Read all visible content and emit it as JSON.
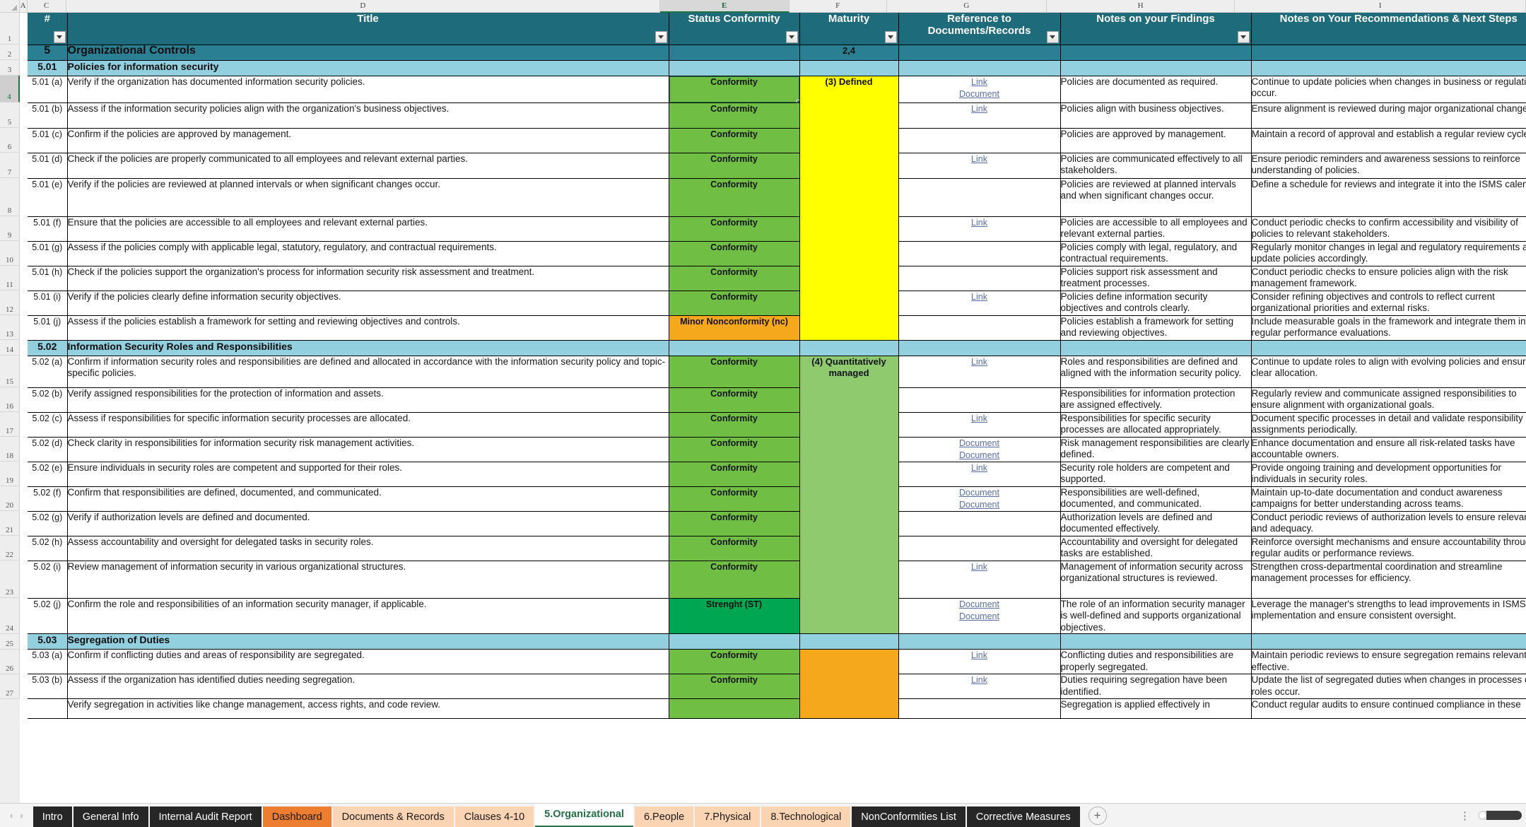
{
  "spreadsheet": {
    "column_letters": [
      "A",
      "C",
      "D",
      "E",
      "F",
      "G",
      "H",
      "I"
    ],
    "selected_column": "E",
    "selected_row": "4",
    "selected_cell_value": "Conformity",
    "row_numbers": [
      "1",
      "2",
      "3",
      "4",
      "5",
      "6",
      "7",
      "8",
      "9",
      "10",
      "11",
      "12",
      "13",
      "14",
      "15",
      "16",
      "17",
      "18",
      "19",
      "20",
      "21",
      "22",
      "23",
      "24",
      "25",
      "26",
      "27"
    ]
  },
  "headers": {
    "num": "#",
    "title": "Title",
    "status": "Status Conformity",
    "maturity": "Maturity",
    "reference": "Reference to\nDocuments/Records",
    "reference_line1": "Reference to",
    "reference_line2": "Documents/Records",
    "findings": "Notes on your Findings",
    "recommendations": "Notes on Your Recommendations & Next Steps"
  },
  "colors": {
    "header_teal": "#1e6b7b",
    "section_main": "#2b7f92",
    "section_sub": "#92cfdf",
    "conformity_green": "#70bf44",
    "minor_orange": "#f5a81c",
    "strength_green": "#00a651",
    "maturity_yellow": "#ffff00",
    "maturity_green": "#8fcb6e",
    "maturity_orange": "#f5a81c",
    "link_blue": "#5b6fa8",
    "excel_accent": "#217346"
  },
  "sections": [
    {
      "type": "section_main",
      "num": "5",
      "title": "Organizational Controls",
      "maturity": "2,4"
    },
    {
      "type": "section_sub",
      "num": "5.01",
      "title": "Policies for information security"
    }
  ],
  "maturity_groups": [
    {
      "label": "(3) Defined",
      "color": "mat-yellow",
      "rows": 10
    },
    {
      "label": "(4) Quantitatively managed",
      "color": "mat-green",
      "rows": 10
    },
    {
      "label": "",
      "color": "mat-orange",
      "rows": 3
    }
  ],
  "rows": [
    {
      "kind": "section_main",
      "num": "5",
      "title": "Organizational Controls",
      "status": "",
      "maturity": "2,4",
      "refs": [],
      "findings": "",
      "recommendations": ""
    },
    {
      "kind": "section_sub",
      "num": "5.01",
      "title": "Policies for information security",
      "status": "",
      "maturity": "",
      "refs": [],
      "findings": "",
      "recommendations": ""
    },
    {
      "kind": "item",
      "num": "5.01 (a)",
      "title": "Verify if the organization has documented information security policies.",
      "status": "Conformity",
      "status_class": "st-conf",
      "refs": [
        "Link",
        "Document"
      ],
      "findings": "Policies are documented as required.",
      "recommendations": "Continue to update policies when changes in business or regulations occur."
    },
    {
      "kind": "item",
      "num": "5.01 (b)",
      "title": "Assess if the information security policies align with the organization's business objectives.",
      "status": "Conformity",
      "status_class": "st-conf",
      "refs": [
        "Link"
      ],
      "findings": "Policies align with business objectives.",
      "recommendations": "Ensure alignment is reviewed during major organizational changes."
    },
    {
      "kind": "item",
      "num": "5.01 (c)",
      "title": "Confirm if the policies are approved by management.",
      "status": "Conformity",
      "status_class": "st-conf",
      "refs": [],
      "findings": "Policies are approved by management.",
      "recommendations": "Maintain a record of approval and establish a regular review cycle."
    },
    {
      "kind": "item",
      "num": "5.01 (d)",
      "title": "Check if the policies are properly communicated to all employees and relevant external parties.",
      "status": "Conformity",
      "status_class": "st-conf",
      "refs": [
        "Link"
      ],
      "findings": "Policies are communicated effectively to all stakeholders.",
      "recommendations": "Ensure periodic reminders and awareness sessions to reinforce understanding of policies."
    },
    {
      "kind": "item",
      "num": "5.01 (e)",
      "title": "Verify if the policies are reviewed at planned intervals or when significant changes occur.",
      "status": "Conformity",
      "status_class": "st-conf",
      "refs": [],
      "findings": "Policies are reviewed at planned intervals and when significant changes occur.",
      "recommendations": "Define a schedule for reviews and integrate it into the ISMS calendar."
    },
    {
      "kind": "item",
      "num": "5.01 (f)",
      "title": "Ensure that the policies are accessible to all employees and relevant external parties.",
      "status": "Conformity",
      "status_class": "st-conf",
      "refs": [
        "Link"
      ],
      "findings": "Policies are accessible to all employees and relevant external parties.",
      "recommendations": "Conduct periodic checks to confirm accessibility and visibility of policies to relevant stakeholders."
    },
    {
      "kind": "item",
      "num": "5.01 (g)",
      "title": "Assess if the policies comply with applicable legal, statutory, regulatory, and contractual requirements.",
      "status": "Conformity",
      "status_class": "st-conf",
      "refs": [],
      "findings": "Policies comply with legal, regulatory, and contractual requirements.",
      "recommendations": "Regularly monitor changes in legal and regulatory requirements and update policies accordingly."
    },
    {
      "kind": "item",
      "num": "5.01 (h)",
      "title": "Check if the policies support the organization's process for information security risk assessment and treatment.",
      "status": "Conformity",
      "status_class": "st-conf",
      "refs": [],
      "findings": "Policies support risk assessment and treatment processes.",
      "recommendations": "Conduct periodic checks to ensure policies align with the risk management framework."
    },
    {
      "kind": "item",
      "num": "5.01 (i)",
      "title": "Verify if the policies clearly define information security objectives.",
      "status": "Conformity",
      "status_class": "st-conf",
      "refs": [
        "Link"
      ],
      "findings": "Policies define information security objectives and controls clearly.",
      "recommendations": "Consider refining objectives and controls to reflect current organizational priorities and external risks."
    },
    {
      "kind": "item",
      "num": "5.01 (j)",
      "title": "Assess if the policies establish a framework for setting and reviewing objectives and controls.",
      "status": "Minor Nonconformity (nc)",
      "status_class": "st-minor",
      "refs": [],
      "findings": "Policies establish a framework for setting and reviewing objectives.",
      "recommendations": "Include measurable goals in the framework and integrate them into regular performance evaluations."
    },
    {
      "kind": "section_sub",
      "num": "5.02",
      "title": "Information Security Roles and Responsibilities",
      "status": "",
      "maturity": "",
      "refs": [],
      "findings": "",
      "recommendations": ""
    },
    {
      "kind": "item",
      "num": "5.02 (a)",
      "title": "Confirm if information security roles and responsibilities are defined and allocated in accordance with the information security policy and topic-specific policies.",
      "status": "Conformity",
      "status_class": "st-conf",
      "refs": [
        "Link"
      ],
      "findings": "Roles and responsibilities are defined and aligned with the information security policy.",
      "recommendations": "Continue to update roles to align with evolving policies and ensure clear allocation."
    },
    {
      "kind": "item",
      "num": "5.02 (b)",
      "title": "Verify assigned responsibilities for the protection of information and assets.",
      "status": "Conformity",
      "status_class": "st-conf",
      "refs": [],
      "findings": "Responsibilities for information protection are assigned effectively.",
      "recommendations": "Regularly review and communicate assigned responsibilities to ensure alignment with organizational goals."
    },
    {
      "kind": "item",
      "num": "5.02 (c)",
      "title": "Assess if responsibilities for specific information security processes are allocated.",
      "status": "Conformity",
      "status_class": "st-conf",
      "refs": [
        "Link"
      ],
      "findings": "Responsibilities for specific security processes are allocated appropriately.",
      "recommendations": "Document specific processes in detail and validate responsibility assignments periodically."
    },
    {
      "kind": "item",
      "num": "5.02 (d)",
      "title": "Check clarity in responsibilities for information security risk management activities.",
      "status": "Conformity",
      "status_class": "st-conf",
      "refs": [
        "Document",
        "Document"
      ],
      "findings": "Risk management responsibilities are clearly defined.",
      "recommendations": "Enhance documentation and ensure all risk-related tasks have accountable owners."
    },
    {
      "kind": "item",
      "num": "5.02 (e)",
      "title": "Ensure individuals in security roles are competent and supported for their roles.",
      "status": "Conformity",
      "status_class": "st-conf",
      "refs": [
        "Link"
      ],
      "findings": "Security role holders are competent and supported.",
      "recommendations": "Provide ongoing training and development opportunities for individuals in security roles."
    },
    {
      "kind": "item",
      "num": "5.02 (f)",
      "title": "Confirm that responsibilities are defined, documented, and communicated.",
      "status": "Conformity",
      "status_class": "st-conf",
      "refs": [
        "Document",
        "Document"
      ],
      "findings": "Responsibilities are well-defined, documented, and communicated.",
      "recommendations": "Maintain up-to-date documentation and conduct awareness campaigns for better understanding across teams."
    },
    {
      "kind": "item",
      "num": "5.02 (g)",
      "title": "Verify if authorization levels are defined and documented.",
      "status": "Conformity",
      "status_class": "st-conf",
      "refs": [],
      "findings": "Authorization levels are defined and documented effectively.",
      "recommendations": "Conduct periodic reviews of authorization levels to ensure relevance and adequacy."
    },
    {
      "kind": "item",
      "num": "5.02 (h)",
      "title": "Assess accountability and oversight for delegated tasks in security roles.",
      "status": "Conformity",
      "status_class": "st-conf",
      "refs": [],
      "findings": "Accountability and oversight for delegated tasks are established.",
      "recommendations": "Reinforce oversight mechanisms and ensure accountability through regular audits or performance reviews."
    },
    {
      "kind": "item",
      "num": "5.02 (i)",
      "title": "Review management of information security in various organizational structures.",
      "status": "Conformity",
      "status_class": "st-conf",
      "refs": [
        "Link"
      ],
      "findings": "Management of information security across organizational structures is reviewed.",
      "recommendations": "Strengthen cross-departmental coordination and streamline management processes for efficiency."
    },
    {
      "kind": "item",
      "num": "5.02 (j)",
      "title": "Confirm the role and responsibilities of an information security manager, if applicable.",
      "status": "Strenght (ST)",
      "status_class": "st-strength",
      "refs": [
        "Document",
        "Document"
      ],
      "findings": "The role of an information security manager is well-defined and supports organizational objectives.",
      "recommendations": "Leverage the manager's strengths to lead improvements in ISMS implementation and ensure consistent oversight."
    },
    {
      "kind": "section_sub",
      "num": "5.03",
      "title": "Segregation of Duties",
      "status": "",
      "maturity": "",
      "refs": [],
      "findings": "",
      "recommendations": ""
    },
    {
      "kind": "item",
      "num": "5.03 (a)",
      "title": "Confirm if conflicting duties and areas of responsibility are segregated.",
      "status": "Conformity",
      "status_class": "st-conf",
      "refs": [
        "Link"
      ],
      "findings": "Conflicting duties and responsibilities are properly segregated.",
      "recommendations": "Maintain periodic reviews to ensure segregation remains relevant and effective."
    },
    {
      "kind": "item",
      "num": "5.03 (b)",
      "title": "Assess if the organization has identified duties needing segregation.",
      "status": "Conformity",
      "status_class": "st-conf",
      "refs": [
        "Link"
      ],
      "findings": "Duties requiring segregation have been identified.",
      "recommendations": "Update the list of segregated duties when changes in processes or roles occur."
    },
    {
      "kind": "item",
      "num": "",
      "title": "Verify segregation in activities like change management, access rights, and code review.",
      "status": "",
      "status_class": "st-conf",
      "refs": [],
      "findings": "Segregation is applied effectively in",
      "recommendations": "Conduct regular audits to ensure continued compliance in these"
    }
  ],
  "sheet_tabs": [
    {
      "label": "Intro",
      "style": "dark"
    },
    {
      "label": "General Info",
      "style": "dark"
    },
    {
      "label": "Internal Audit Report",
      "style": "dark"
    },
    {
      "label": "Dashboard",
      "style": "orange"
    },
    {
      "label": "Documents & Records",
      "style": "peach"
    },
    {
      "label": "Clauses 4-10",
      "style": "peach"
    },
    {
      "label": "5.Organizational",
      "style": "active"
    },
    {
      "label": "6.People",
      "style": "peach"
    },
    {
      "label": "7.Physical",
      "style": "peach"
    },
    {
      "label": "8.Technological",
      "style": "peach"
    },
    {
      "label": "NonConformities List",
      "style": "dark"
    },
    {
      "label": "Corrective Measures",
      "style": "dark"
    }
  ],
  "tabbar": {
    "prev_arrow": "‹",
    "next_arrow": "›",
    "add_sheet": "+",
    "kebab": "⋮"
  }
}
